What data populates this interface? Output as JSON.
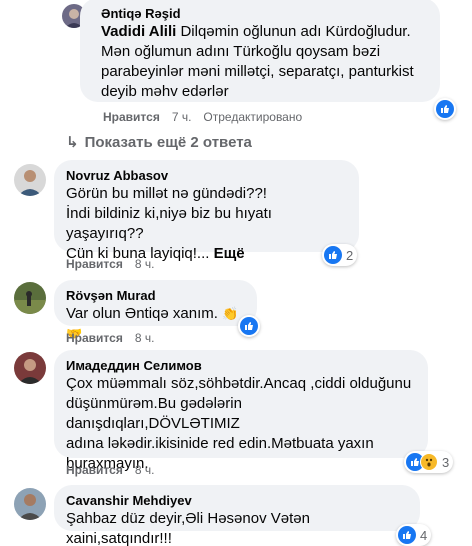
{
  "comments": [
    {
      "author": "Əntiqə Rəşid",
      "mention": "Vadidi Alili",
      "text_line1": " Dilqəmin oğlunun adı Kürdoğludur.",
      "text_rest": [
        "Mən oğlumun adını Türkoğlu qoysam bəzi",
        "parabeyinlər məni millətçi, separatçı, panturkist",
        "deyib məhv edərlər"
      ],
      "like": "Нравится",
      "time": "7 ч.",
      "status": "Отредактировано"
    },
    {
      "author": "Novruz Abbasov",
      "lines": [
        "Görün bu millət nə gündədi??!",
        "İndi bildiniz ki,niyə biz bu hıyatı yaşayırıq??",
        "Cün ki buna layiqiq!..."
      ],
      "more": "Ещё",
      "like": "Нравится",
      "time": "8 ч.",
      "reactions": "2"
    },
    {
      "author": "Rövşən Murad",
      "text": "Var olun Əntiqə xanım.",
      "like": "Нравится",
      "time": "8 ч."
    },
    {
      "author": "Имадеддин Селимов",
      "lines": [
        "Çox müəmmalı söz,söhbətdir.Ancaq ,ciddi olduğunu",
        "düşünmürəm.Bu gədələrin danışdıqları,DÖVLƏTIMIZ",
        "adına ləkədir.ikisinide red edin.Mətbuata yaxın",
        "buraxmayın."
      ],
      "like": "Нравится",
      "time": "8 ч.",
      "reactions": "3"
    },
    {
      "author": "Cavanshir Mehdiyev",
      "text": "Şahbaz düz deyir,Əli Həsənov Vətən xaini,satqındır!!!",
      "reactions": "4"
    }
  ],
  "replies_link": "Показать ещё 2 ответа"
}
